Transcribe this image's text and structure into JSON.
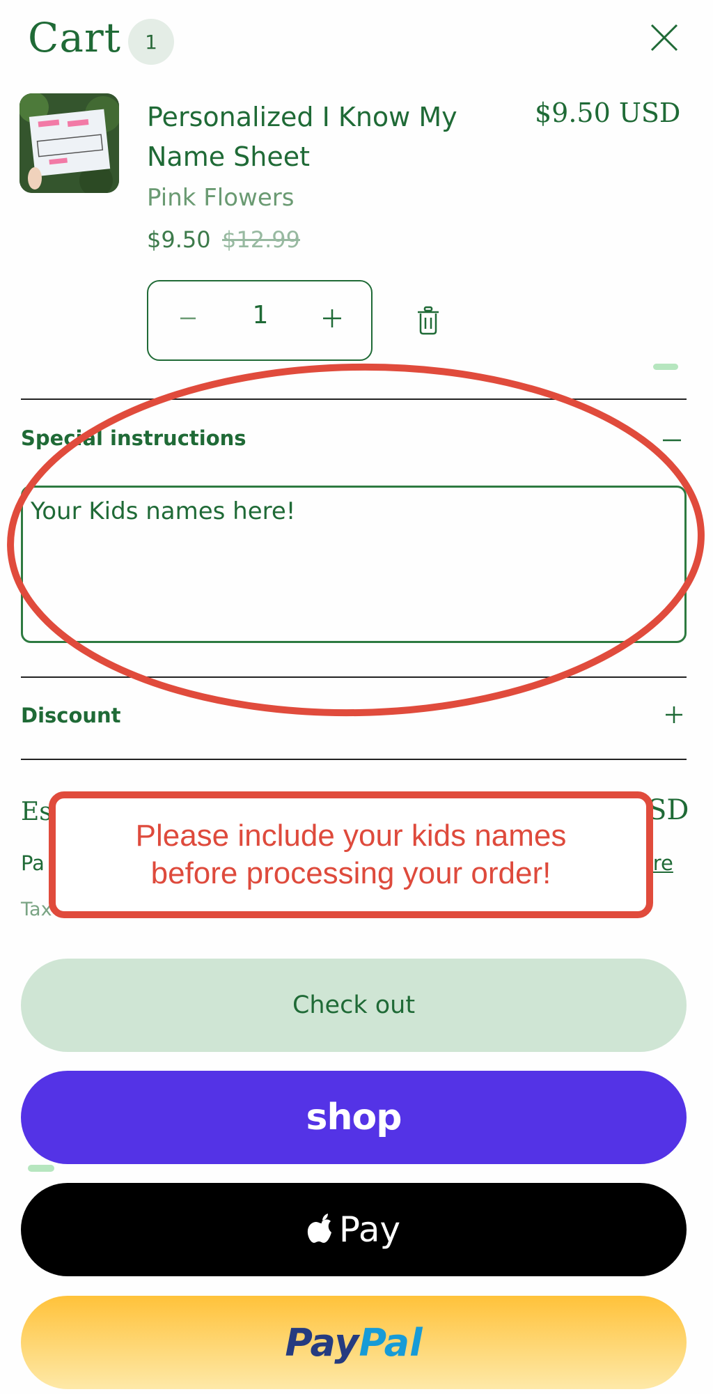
{
  "header": {
    "title": "Cart",
    "count": "1"
  },
  "item": {
    "title": "Personalized I Know My Name Sheet",
    "price": "$9.50 USD",
    "variant": "Pink Flowers",
    "sale_price": "$9.50",
    "compare_price": "$12.99",
    "quantity": "1"
  },
  "special_instructions": {
    "label": "Special instructions",
    "value": "Your Kids names here!"
  },
  "discount": {
    "label": "Discount"
  },
  "summary": {
    "estimated_label": "Es",
    "estimated_value": "SD",
    "payment_label": "Pa",
    "more_link": "ore",
    "tax_label": "Tax"
  },
  "notice": {
    "line1": "Please include your kids names",
    "line2": "before processing your order!"
  },
  "buttons": {
    "checkout": "Check out",
    "shop": "shop",
    "apple_pay": "Pay",
    "paypal_part1": "Pay",
    "paypal_part2": "Pal"
  },
  "colors": {
    "accent_green": "#1f6a36",
    "annotation_red": "#e04b3c",
    "shop_purple": "#5433e6",
    "checkout_bg": "#cfe5d4"
  },
  "icons": [
    "close-icon",
    "minus-icon",
    "plus-icon",
    "trash-icon",
    "apple-icon"
  ]
}
